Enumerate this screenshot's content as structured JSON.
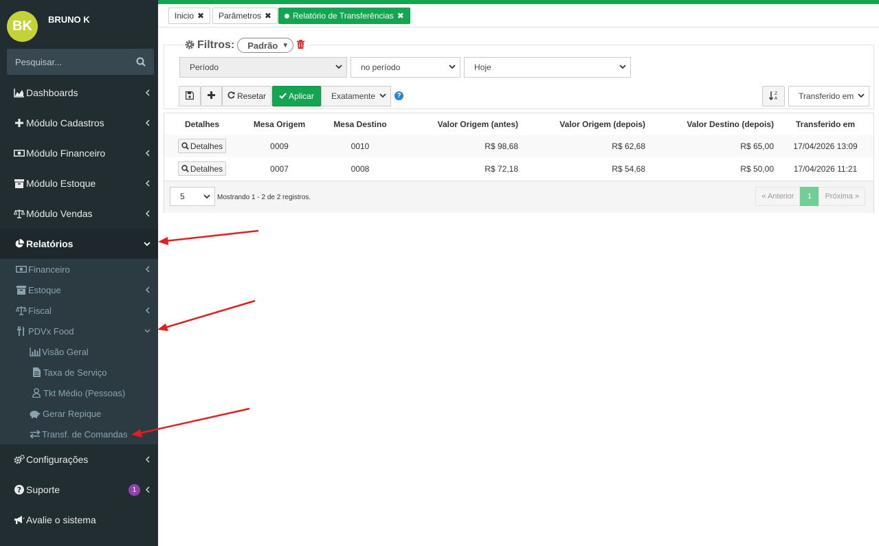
{
  "user": {
    "initials": "BK",
    "name": "BRUNO K"
  },
  "search": {
    "placeholder": "Pesquisar..."
  },
  "menu": {
    "dashboards": "Dashboards",
    "cadastros": "Módulo Cadastros",
    "financeiro": "Módulo Financeiro",
    "estoque": "Módulo Estoque",
    "vendas": "Módulo Vendas",
    "relatorios": "Relatórios",
    "configuracoes": "Configurações",
    "suporte": "Suporte",
    "suporte_badge": "1",
    "avalie": "Avalie o sistema"
  },
  "submenu": {
    "financeiro": "Financeiro",
    "estoque": "Estoque",
    "fiscal": "Fiscal",
    "pdvx": "PDVx Food",
    "visao": "Visão Geral",
    "taxa": "Taxa de Serviço",
    "tkt": "Tkt Médio (Pessoas)",
    "repique": "Gerar Repique",
    "transf": "Transf. de Comandas"
  },
  "tabs": {
    "inicio": "Inicio",
    "parametros": "Parâmetros",
    "relatorio": "Relatório de Transferências"
  },
  "filters": {
    "title": "Filtros:",
    "preset": "Padrão",
    "field": "Período",
    "operator": "no período",
    "value": "Hoje",
    "reset": "Resetar",
    "apply": "Aplicar",
    "match": "Exatamente",
    "sort_field": "Transferido em"
  },
  "table": {
    "headers": [
      "Detalhes",
      "Mesa Origem",
      "Mesa Destino",
      "Valor Origem (antes)",
      "Valor Origem (depois)",
      "Valor Destino (depois)",
      "Transferido em"
    ],
    "rows": [
      {
        "details": "Detalhes",
        "mesa_origem": "0009",
        "mesa_destino": "0010",
        "valor_antes": "R$ 98,68",
        "valor_depois": "R$ 62,68",
        "valor_destino": "R$ 65,00",
        "transferido": "17/04/2026 13:09"
      },
      {
        "details": "Detalhes",
        "mesa_origem": "0007",
        "mesa_destino": "0008",
        "valor_antes": "R$ 72,18",
        "valor_depois": "R$ 54,68",
        "valor_destino": "R$ 50,00",
        "transferido": "17/04/2026 11:21"
      }
    ],
    "page_size": "5",
    "showing": "Mostrando 1 - 2 de 2 registros.",
    "prev": "« Anterior",
    "current_page": "1",
    "next": "Próxima »"
  },
  "colors": {
    "brand_green": "#13a551",
    "sidebar_bg": "#222d32",
    "avatar": "#c3d237",
    "annotation_red": "#e02020"
  }
}
